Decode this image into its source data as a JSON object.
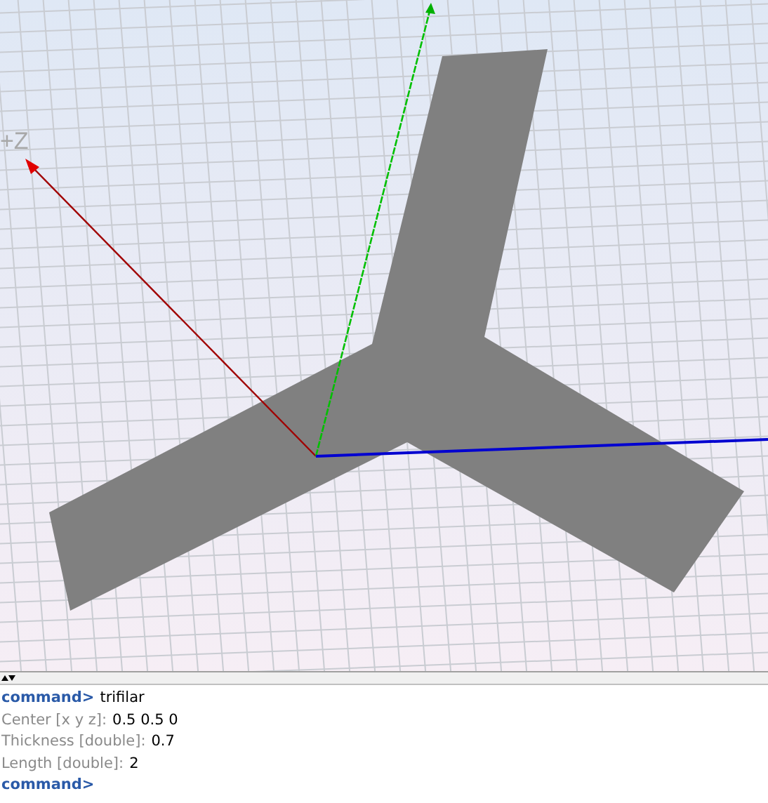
{
  "viewport": {
    "axis_label": "+Z"
  },
  "console": {
    "lines": [
      {
        "kind": "command",
        "prompt": "command>",
        "value": "trifilar"
      },
      {
        "kind": "input",
        "label": "Center [x y z]:",
        "value": "0.5 0.5 0"
      },
      {
        "kind": "input",
        "label": "Thickness [double]:",
        "value": "0.7"
      },
      {
        "kind": "input",
        "label": "Length [double]:",
        "value": "2"
      },
      {
        "kind": "command",
        "prompt": "command>"
      }
    ]
  }
}
